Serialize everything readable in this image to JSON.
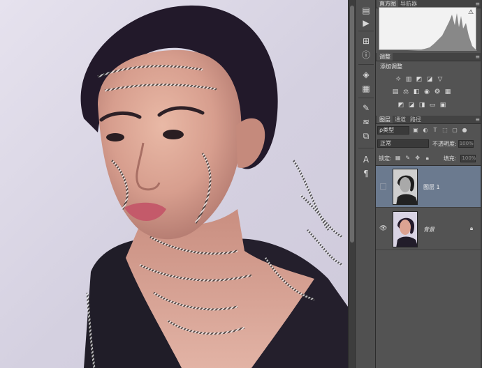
{
  "panels": {
    "histogram": {
      "tabs": [
        "直方图",
        "导航器"
      ],
      "menu_icon": "panel-menu-icon",
      "warning_icon": "warning-triangle-icon"
    },
    "adjustments": {
      "tab": "调整",
      "title": "添加调整",
      "icons_row1": [
        "brightness-icon",
        "levels-icon",
        "curves-icon",
        "exposure-icon",
        "vibrance-triangle-icon"
      ],
      "icons_row2": [
        "hue-saturation-icon",
        "color-balance-icon",
        "black-white-icon",
        "photo-filter-icon",
        "channel-mixer-icon",
        "color-lookup-icon"
      ],
      "icons_row3": [
        "invert-icon",
        "posterize-icon",
        "threshold-icon",
        "gradient-map-icon",
        "selective-color-icon"
      ]
    },
    "layers": {
      "tabs": [
        "图层",
        "通道",
        "路径"
      ],
      "kind_filter": "ρ类型",
      "blend_mode": "正常",
      "opacity_label": "不透明度:",
      "opacity_value": "100%",
      "lock_label": "锁定:",
      "fill_label": "填充:",
      "fill_value": "100%",
      "items": [
        {
          "name": "图层 1",
          "selected": true,
          "visible": false,
          "locked": false
        },
        {
          "name": "背景",
          "selected": false,
          "visible": true,
          "locked": true
        }
      ]
    }
  },
  "tools": [
    "history-brush-icon",
    "play-icon",
    "layer-comps-icon",
    "info-icon",
    "three-d-icon",
    "grid-icon",
    "brush-icon",
    "brush-presets-icon",
    "clone-source-icon",
    "character-icon",
    "paragraph-icon"
  ],
  "colors": {
    "selected_layer": "#6b7a8f",
    "panel_bg": "#535353",
    "canvas_bg": "#d8d4e3"
  }
}
